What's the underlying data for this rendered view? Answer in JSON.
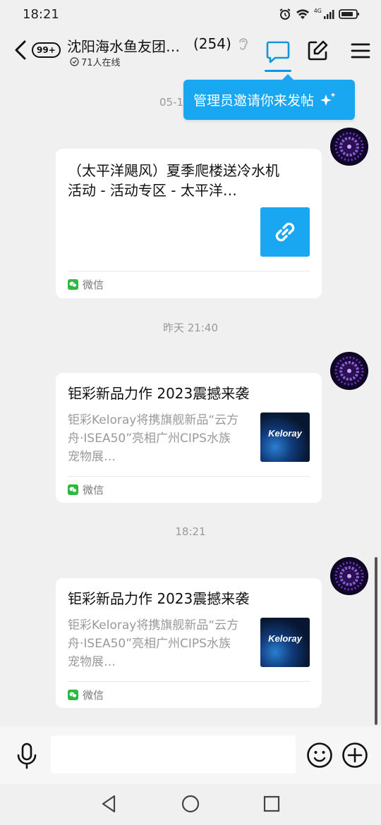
{
  "status_bar": {
    "time": "18:21",
    "network": "4G"
  },
  "header": {
    "back_badge": "99+",
    "title": "沈阳海水鱼友团…",
    "member_count": "(254)",
    "online": "71人在线"
  },
  "tooltip": {
    "text": "管理员邀请你来发帖"
  },
  "messages": [
    {
      "timestamp_partial": "05-1",
      "title": "（太平洋飓风）夏季爬楼送冷水机活动 - 活动专区 - 太平洋…",
      "title_line1": "（太平洋飓风）夏季爬楼送冷水机",
      "title_line2": "活动 - 活动专区 - 太平洋…",
      "source": "微信",
      "thumb": "link-icon"
    },
    {
      "timestamp": "昨天 21:40",
      "title": "钜彩新品力作 2023震撼来袭",
      "desc_line1": "钜彩Keloray将携旗舰新品“云方",
      "desc_line2": "舟·ISEA50”亮相广州CIPS水族",
      "desc_line3": "宠物展…",
      "thumb_text": "Keloray",
      "source": "微信"
    },
    {
      "timestamp": "18:21",
      "title": "钜彩新品力作 2023震撼来袭",
      "desc_line1": "钜彩Keloray将携旗舰新品“云方",
      "desc_line2": "舟·ISEA50”亮相广州CIPS水族",
      "desc_line3": "宠物展…",
      "thumb_text": "Keloray",
      "source": "微信"
    }
  ],
  "input": {
    "placeholder": ""
  },
  "colors": {
    "accent": "#1296db",
    "tooltip_bg": "#1aa7f2",
    "wechat_green": "#2db840",
    "background": "#f0f0f0"
  }
}
